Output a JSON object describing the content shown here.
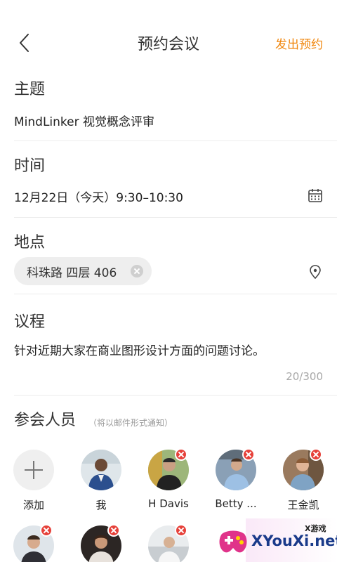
{
  "header": {
    "title": "预约会议",
    "send_label": "发出预约"
  },
  "topic": {
    "label": "主题",
    "value": "MindLinker 视觉概念评审"
  },
  "time": {
    "label": "时间",
    "value": "12月22日（今天）9:30–10:30"
  },
  "location": {
    "label": "地点",
    "chip": "科珠路 四层 406"
  },
  "agenda": {
    "label": "议程",
    "value": "针对近期大家在商业图形设计方面的问题讨论。",
    "counter": "20/300"
  },
  "attendees": {
    "label": "参会人员",
    "note": "（将以邮件形式通知）",
    "add_label": "添加",
    "people": [
      {
        "name": "我"
      },
      {
        "name": "H Davis"
      },
      {
        "name": "Betty ..."
      },
      {
        "name": "王金凯"
      }
    ]
  },
  "watermark": {
    "text": "XYouXi.net",
    "small": "X游戏"
  },
  "colors": {
    "accent": "#f0860c",
    "remove": "#e6413a"
  }
}
